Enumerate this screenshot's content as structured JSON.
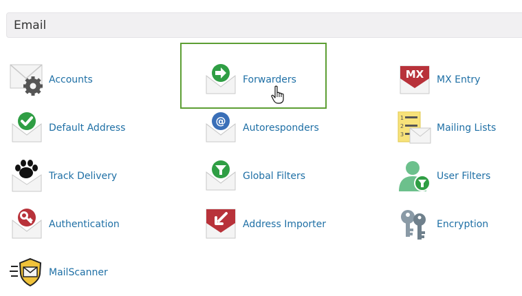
{
  "section": {
    "title": "Email"
  },
  "items": [
    {
      "label": "Accounts",
      "icon": "mail-gear-icon"
    },
    {
      "label": "Forwarders",
      "icon": "mail-forward-icon"
    },
    {
      "label": "MX Entry",
      "icon": "mx-entry-icon"
    },
    {
      "label": "Default Address",
      "icon": "mail-check-icon"
    },
    {
      "label": "Autoresponders",
      "icon": "mail-at-icon"
    },
    {
      "label": "Mailing Lists",
      "icon": "mailing-list-icon"
    },
    {
      "label": "Track Delivery",
      "icon": "paw-print-icon"
    },
    {
      "label": "Global Filters",
      "icon": "mail-filter-icon"
    },
    {
      "label": "User Filters",
      "icon": "user-filter-icon"
    },
    {
      "label": "Authentication",
      "icon": "mail-key-icon"
    },
    {
      "label": "Address Importer",
      "icon": "mail-import-icon"
    },
    {
      "label": "Encryption",
      "icon": "keys-icon"
    },
    {
      "label": "MailScanner",
      "icon": "mailscanner-shield-icon"
    }
  ],
  "colors": {
    "link": "#1e6fa5",
    "highlight_border": "#5c9e33",
    "header_bg": "#f1f0f2",
    "green_icon": "#2f9e44",
    "red_icon": "#b8323a",
    "blue_icon": "#3a6fb8"
  },
  "state": {
    "highlighted_item": "Forwarders"
  }
}
